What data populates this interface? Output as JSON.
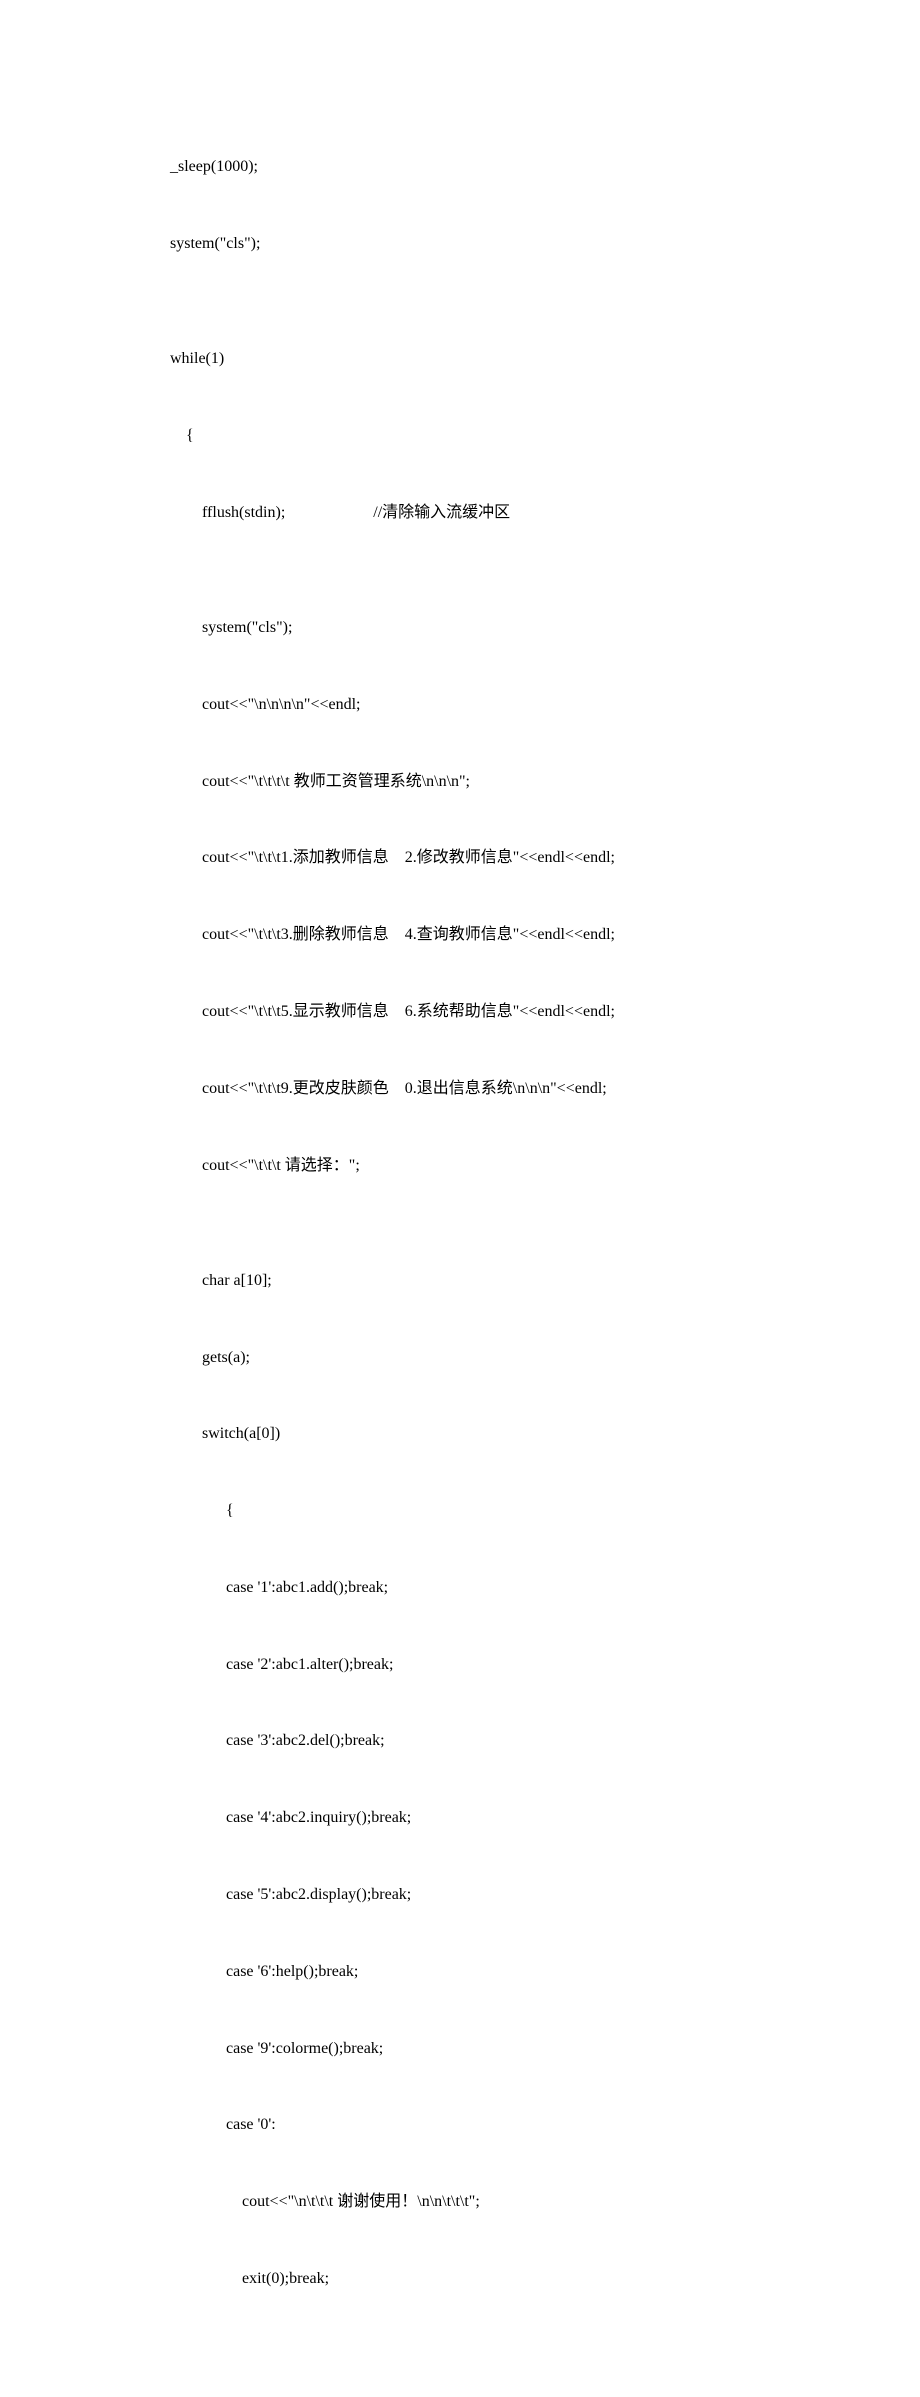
{
  "code": {
    "lines": [
      "_sleep(1000);",
      "system(\"cls\");",
      "",
      "while(1)",
      "    {",
      "        fflush(stdin);                      //清除输入流缓冲区",
      "",
      "        system(\"cls\");",
      "        cout<<\"\\n\\n\\n\\n\"<<endl;",
      "        cout<<\"\\t\\t\\t\\t 教师工资管理系统\\n\\n\\n\";",
      "        cout<<\"\\t\\t\\t1.添加教师信息    2.修改教师信息\"<<endl<<endl;",
      "        cout<<\"\\t\\t\\t3.删除教师信息    4.查询教师信息\"<<endl<<endl;",
      "        cout<<\"\\t\\t\\t5.显示教师信息    6.系统帮助信息\"<<endl<<endl;",
      "        cout<<\"\\t\\t\\t9.更改皮肤颜色    0.退出信息系统\\n\\n\\n\"<<endl;",
      "        cout<<\"\\t\\t\\t 请选择：\";",
      "",
      "        char a[10];",
      "        gets(a);",
      "        switch(a[0])",
      "              {",
      "              case '1':abc1.add();break;",
      "              case '2':abc1.alter();break;",
      "              case '3':abc2.del();break;",
      "              case '4':abc2.inquiry();break;",
      "              case '5':abc2.display();break;",
      "              case '6':help();break;",
      "              case '9':colorme();break;",
      "              case '0':",
      "                  cout<<\"\\n\\t\\t\\t 谢谢使用！\\n\\n\\t\\t\\t\";",
      "                  exit(0);break;"
    ]
  }
}
